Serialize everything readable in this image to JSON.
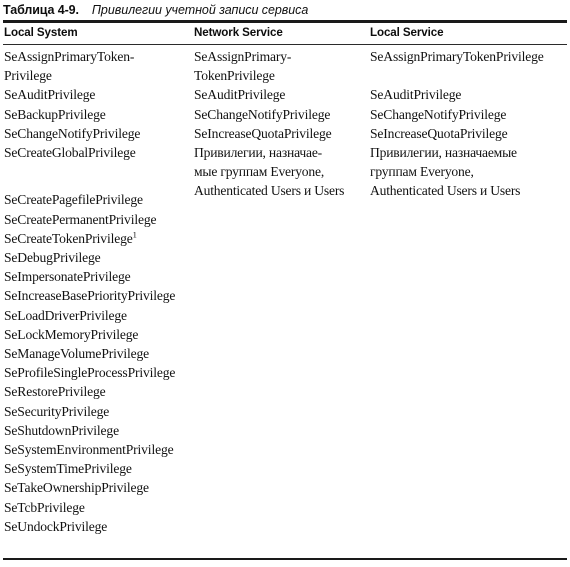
{
  "caption": {
    "label": "Таблица 4-9.",
    "title": "Привилегии учетной записи сервиса"
  },
  "table": {
    "headers": [
      "Local System",
      "Network Service",
      "Local Service"
    ],
    "columns": {
      "local_system": [
        "SeAssignPrimaryToken-\nPrivilege",
        "SeAuditPrivilege",
        "SeBackupPrivilege",
        "SeChangeNotifyPrivilege",
        "SeCreateGlobalPrivilege",
        "SeCreatePagefilePrivilege",
        "SeCreatePermanentPrivilege",
        "SeCreateTokenPrivilege",
        "SeDebugPrivilege",
        "SeImpersonatePrivilege",
        "SeIncreaseBasePriorityPrivilege",
        "SeLoadDriverPrivilege",
        "SeLockMemoryPrivilege",
        "SeManageVolumePrivilege",
        "SeProfileSingleProcessPrivilege",
        "SeRestorePrivilege",
        "SeSecurityPrivilege",
        "SeShutdownPrivilege",
        "SeSystemEnvironmentPrivilege",
        "SeSystemTimePrivilege",
        "SeTakeOwnershipPrivilege",
        "SeTcbPrivilege",
        "SeUndockPrivilege"
      ],
      "local_system_footnote_marker": "1",
      "local_system_footnote_on_index": 7,
      "network_service": [
        "SeAssignPrimary-\nTokenPrivilege",
        "SeAuditPrivilege",
        "SeChangeNotifyPrivilege",
        "SeIncreaseQuotaPrivilege",
        "Привилегии, назначае-\nмые группам Everyone,\nAuthenticated Users и Users"
      ],
      "local_service": [
        "SeAssignPrimaryTokenPrivilege",
        "SeAuditPrivilege",
        "SeChangeNotifyPrivilege",
        "SeIncreaseQuotaPrivilege",
        "Привилегии, назначаемые\nгруппам Everyone,\nAuthenticated Users и Users"
      ]
    }
  },
  "colors": {
    "background": "#ffffff",
    "text": "#121212",
    "rule": "#1a1a1a"
  }
}
